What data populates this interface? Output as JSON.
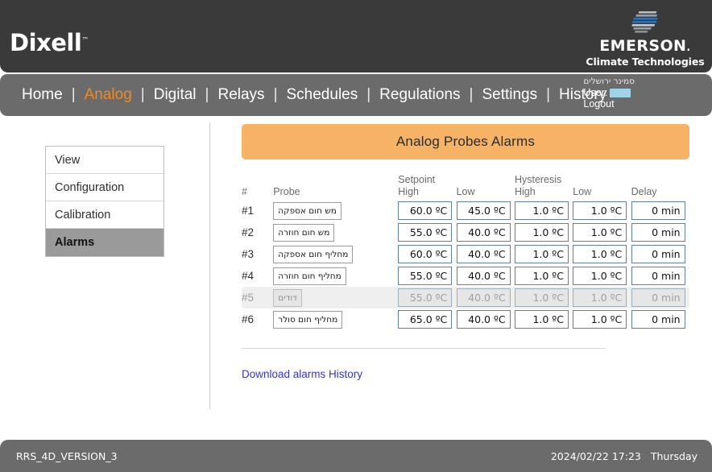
{
  "header": {
    "brand": "Dixell",
    "brand_tm": "™",
    "partner_name": "EMERSON",
    "partner_name_dot": ".",
    "partner_tagline": "Climate Technologies",
    "bar_color": "#3a3a3a"
  },
  "nav": {
    "separator": "|",
    "items": [
      {
        "label": "Home",
        "active": false
      },
      {
        "label": "Analog",
        "active": true
      },
      {
        "label": "Digital",
        "active": false
      },
      {
        "label": "Relays",
        "active": false
      },
      {
        "label": "Schedules",
        "active": false
      },
      {
        "label": "Regulations",
        "active": false
      },
      {
        "label": "Settings",
        "active": false
      },
      {
        "label": "History",
        "active": false
      }
    ],
    "active_color": "#f08a24",
    "bar_color": "#6b6b6b"
  },
  "user": {
    "site": "סמינר ירושלים",
    "user_label": "User:",
    "user_value": "",
    "logout_label": "Logout"
  },
  "sidebar": {
    "items": [
      {
        "label": "View",
        "active": false
      },
      {
        "label": "Configuration",
        "active": false
      },
      {
        "label": "Calibration",
        "active": false
      },
      {
        "label": "Alarms",
        "active": true
      }
    ]
  },
  "panel": {
    "title": "Analog Probes Alarms",
    "title_bg": "#f6b366",
    "group_headers": {
      "setpoint": "Setpoint",
      "hysteresis": "Hysteresis"
    },
    "columns": {
      "index": "#",
      "probe": "Probe",
      "setpoint_high": "High",
      "setpoint_low": "Low",
      "hysteresis_high": "High",
      "hysteresis_low": "Low",
      "delay": "Delay"
    },
    "rows": [
      {
        "index": "#1",
        "probe": "מש חום אספקה",
        "setpoint_high": "60.0 ºC",
        "setpoint_low": "45.0 ºC",
        "hysteresis_high": "1.0 ºC",
        "hysteresis_low": "1.0 ºC",
        "delay": "0 min",
        "disabled": false
      },
      {
        "index": "#2",
        "probe": "מש חום חוזרה",
        "setpoint_high": "55.0 ºC",
        "setpoint_low": "40.0 ºC",
        "hysteresis_high": "1.0 ºC",
        "hysteresis_low": "1.0 ºC",
        "delay": "0 min",
        "disabled": false
      },
      {
        "index": "#3",
        "probe": "מחליף חום אספקה",
        "setpoint_high": "60.0 ºC",
        "setpoint_low": "40.0 ºC",
        "hysteresis_high": "1.0 ºC",
        "hysteresis_low": "1.0 ºC",
        "delay": "0 min",
        "disabled": false
      },
      {
        "index": "#4",
        "probe": "מחליף חום חוזרה",
        "setpoint_high": "55.0 ºC",
        "setpoint_low": "40.0 ºC",
        "hysteresis_high": "1.0 ºC",
        "hysteresis_low": "1.0 ºC",
        "delay": "0 min",
        "disabled": false
      },
      {
        "index": "#5",
        "probe": "דודים",
        "setpoint_high": "55.0 ºC",
        "setpoint_low": "40.0 ºC",
        "hysteresis_high": "1.0 ºC",
        "hysteresis_low": "1.0 ºC",
        "delay": "0 min",
        "disabled": true
      },
      {
        "index": "#6",
        "probe": "מחליף חום סולר",
        "setpoint_high": "65.0 ºC",
        "setpoint_low": "40.0 ºC",
        "hysteresis_high": "1.0 ºC",
        "hysteresis_low": "1.0 ºC",
        "delay": "0 min",
        "disabled": false
      }
    ],
    "download_link": "Download alarms History"
  },
  "footer": {
    "version": "RRS_4D_VERSION_3",
    "datetime": "2024/02/22 17:23",
    "weekday": "Thursday",
    "bar_color": "#6b6b6b"
  }
}
